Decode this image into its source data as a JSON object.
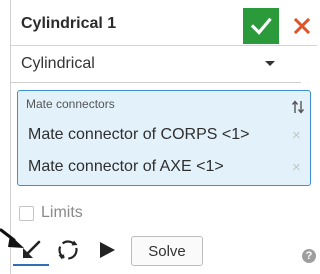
{
  "dialog": {
    "title": "Cylindrical 1",
    "type_select": {
      "value": "Cylindrical"
    },
    "mate_connectors": {
      "label": "Mate connectors",
      "items": [
        {
          "label": "Mate connector of CORPS <1>",
          "remove": "×"
        },
        {
          "label": "Mate connector of AXE <1>",
          "remove": "×"
        }
      ]
    },
    "limits": {
      "label": "Limits",
      "checked": false
    },
    "toolbar": {
      "solve_label": "Solve"
    },
    "help_label": "?"
  },
  "colors": {
    "accept": "#2a9a3a",
    "cancel": "#e0522a",
    "selection_bg": "#e3f1fb",
    "selection_border": "#3f8fd2",
    "active_underline": "#2f6fb8"
  },
  "icons": {
    "accept": "check-icon",
    "cancel": "close-icon",
    "dropdown": "chevron-down-icon",
    "sort": "sort-arrows-icon",
    "direction": "arrow-direction-icon",
    "rotate": "rotate-icon",
    "animate": "play-icon",
    "help": "help-icon"
  }
}
